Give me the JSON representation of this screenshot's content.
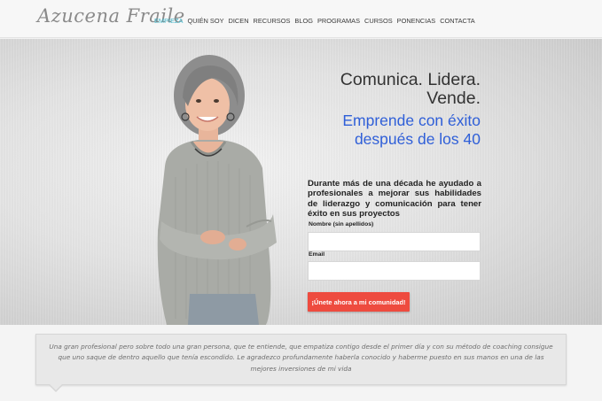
{
  "header": {
    "logo": "Azucena Fraile",
    "nav": [
      "EMPIEZA",
      "QUIÉN SOY",
      "DICEN",
      "RECURSOS",
      "BLOG",
      "PROGRAMAS",
      "CURSOS",
      "PONENCIAS",
      "CONTACTA"
    ],
    "active_index": 0
  },
  "hero": {
    "headline": [
      "Comunica. Lidera.",
      "Vende."
    ],
    "subhead": [
      "Emprende con éxito",
      "después de los 40"
    ],
    "intro": "Durante más de una década he ayudado a profesionales a mejorar sus habilidades de liderazgo y comunicación para tener éxito en sus proyectos",
    "form": {
      "name_label": "Nombre (sin apellidos)",
      "name_value": "",
      "email_label": "Email",
      "email_value": "",
      "submit_label": "¡Únete ahora a mi comunidad!"
    }
  },
  "testimonial": {
    "text": "Una gran profesional pero sobre todo una gran persona, que te entiende, que empatiza contigo desde el primer día y con su método de coaching consigue que uno saque de dentro aquello que tenía escondido. Le agradezco profundamente haberla conocido y haberme puesto en sus manos en una de las mejores inversiones de mi vida"
  },
  "colors": {
    "accent": "#3fb4c8",
    "subhead": "#2f5fd8",
    "cta": "#ee4b3f"
  }
}
